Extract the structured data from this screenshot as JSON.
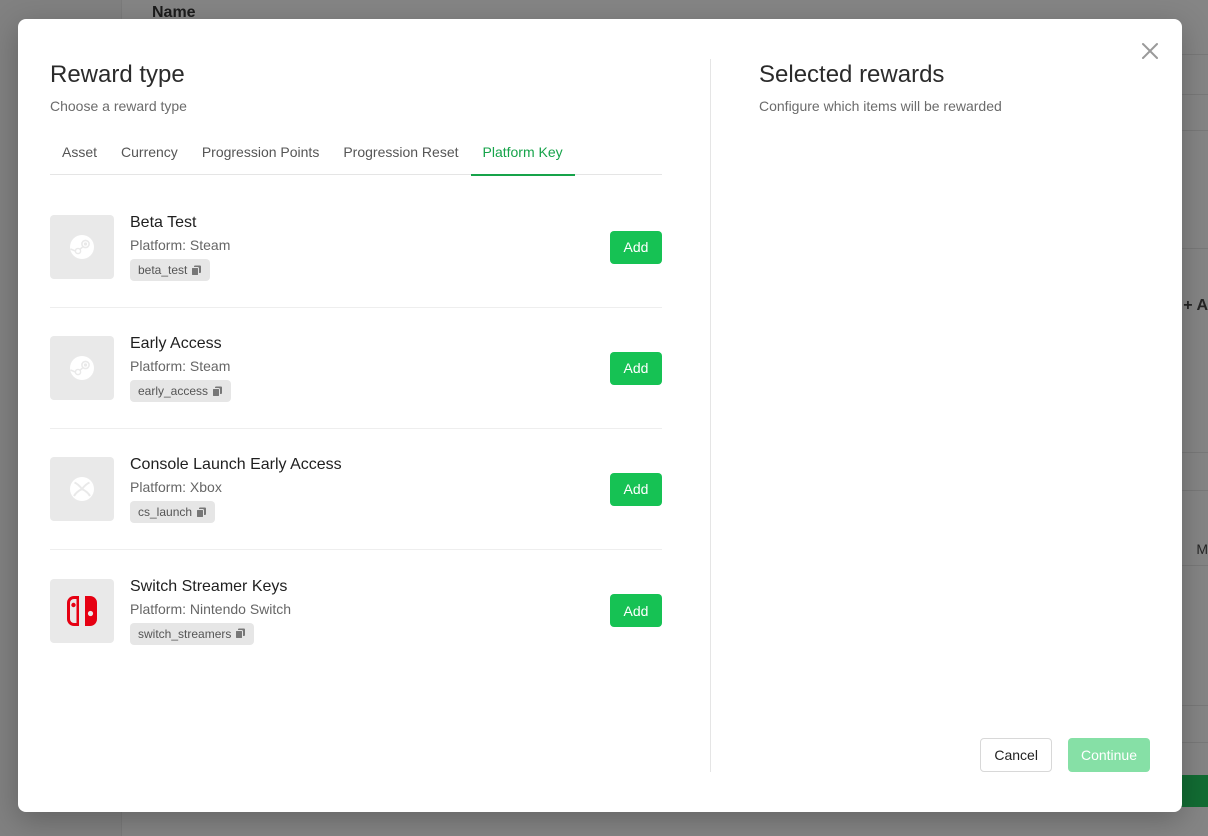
{
  "background": {
    "header_name": "Name",
    "right_add_label": "+ A",
    "right_m_label": "M"
  },
  "modal": {
    "left": {
      "title": "Reward type",
      "subtitle": "Choose a reward type",
      "tabs": [
        {
          "label": "Asset",
          "active": false
        },
        {
          "label": "Currency",
          "active": false
        },
        {
          "label": "Progression Points",
          "active": false
        },
        {
          "label": "Progression Reset",
          "active": false
        },
        {
          "label": "Platform Key",
          "active": true
        }
      ],
      "items": [
        {
          "name": "Beta Test",
          "platform": "Platform: Steam",
          "key": "beta_test",
          "icon": "steam-icon",
          "add_label": "Add"
        },
        {
          "name": "Early Access",
          "platform": "Platform: Steam",
          "key": "early_access",
          "icon": "steam-icon",
          "add_label": "Add"
        },
        {
          "name": "Console Launch Early Access",
          "platform": "Platform: Xbox",
          "key": "cs_launch",
          "icon": "xbox-icon",
          "add_label": "Add"
        },
        {
          "name": "Switch Streamer Keys",
          "platform": "Platform: Nintendo Switch",
          "key": "switch_streamers",
          "icon": "nintendo-switch-icon",
          "add_label": "Add"
        }
      ]
    },
    "right": {
      "title": "Selected rewards",
      "subtitle": "Configure which items will be rewarded"
    },
    "footer": {
      "cancel_label": "Cancel",
      "continue_label": "Continue"
    },
    "colors": {
      "accent": "#16a34a",
      "add_button": "#16c254",
      "continue_disabled": "#86e0a6",
      "switch_red": "#e60012"
    }
  }
}
